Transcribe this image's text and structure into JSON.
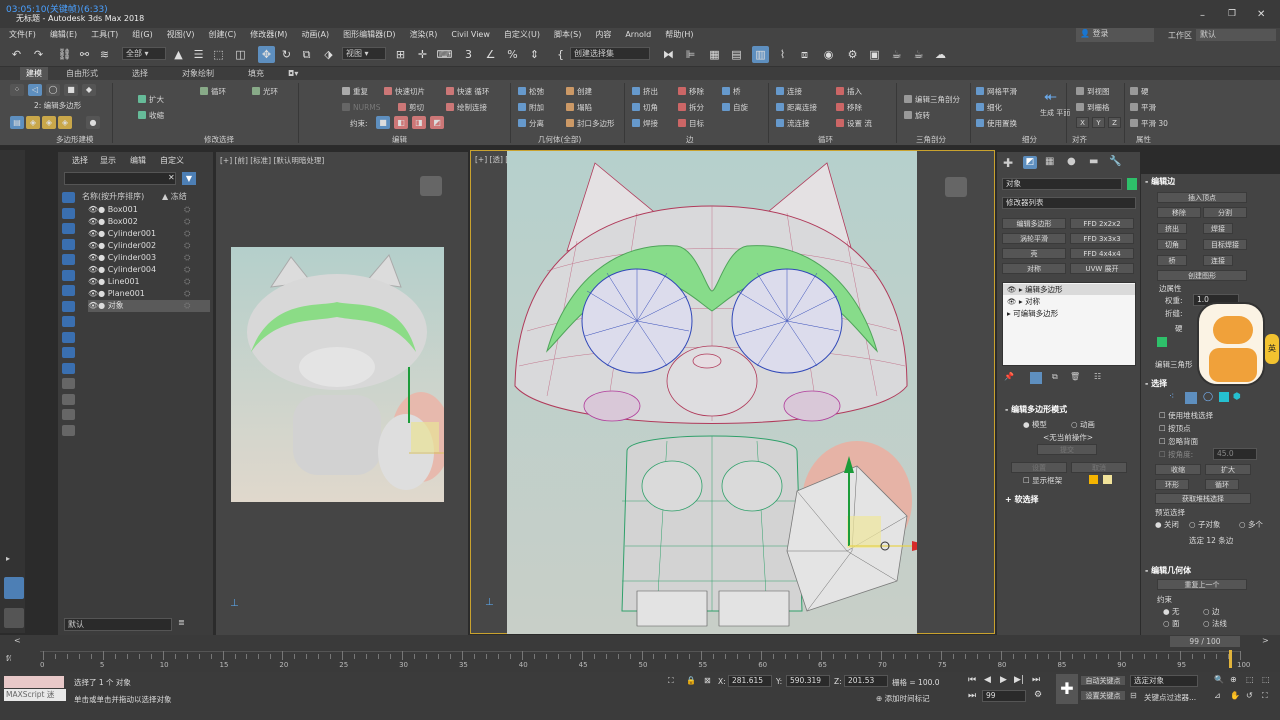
{
  "window": {
    "title": "无标题 - Autodesk 3ds Max 2018",
    "overlay": "03:05:10(关键帧)(6:33)"
  },
  "menu": [
    "文件(F)",
    "编辑(E)",
    "工具(T)",
    "组(G)",
    "视图(V)",
    "创建(C)",
    "修改器(M)",
    "动画(A)",
    "图形编辑器(D)",
    "渲染(R)",
    "Civil View",
    "自定义(U)",
    "脚本(S)",
    "内容",
    "Arnold",
    "帮助(H)"
  ],
  "menu_right": {
    "login": "登录",
    "workspace_label": "工作区",
    "workspace_value": "默认"
  },
  "toolbar": {
    "filter": "全部",
    "view": "视图",
    "selection_set": "创建选择集"
  },
  "ribbon_tabs": [
    "建模",
    "自由形式",
    "选择",
    "对象绘制",
    "填充"
  ],
  "ribbon": {
    "poly_mode": "2: 编辑多边形",
    "groups": [
      "多边形建模",
      "修改选择",
      "编辑",
      "几何体(全部)",
      "边",
      "循环",
      "三角剖分",
      "细分",
      "对齐",
      "属性"
    ],
    "modify_sel": [
      "扩大",
      "收缩",
      "循环",
      "光环"
    ],
    "edit": [
      "重复",
      "快速切片",
      "快速 循环",
      "NURMS",
      "剪切",
      "绘制连接",
      "约束:"
    ],
    "geometry": [
      "松弛",
      "创建",
      "附加",
      "塌陷",
      "分离",
      "封口多边形"
    ],
    "edge": [
      "挤出",
      "移除",
      "桥",
      "切角",
      "拆分",
      "自旋",
      "焊接",
      "目标"
    ],
    "loop": [
      "连接",
      "插入",
      "距离连接",
      "移除",
      "流连接",
      "设置 流"
    ],
    "tri": [
      "编辑三角剖分",
      "旋转"
    ],
    "subdiv": [
      "网格平滑",
      "细化",
      "使用置换",
      "生成 平面"
    ],
    "align": [
      "到视图",
      "到栅格",
      "X",
      "Y",
      "Z"
    ],
    "props": [
      "硬",
      "平滑",
      "平滑 30"
    ]
  },
  "scene_explorer": {
    "tabs": [
      "选择",
      "显示",
      "编辑",
      "自定义"
    ],
    "col_name": "名称(按升序排序)",
    "col_freeze": "▲ 冻结",
    "items": [
      "Box001",
      "Box002",
      "Cylinder001",
      "Cylinder002",
      "Cylinder003",
      "Cylinder004",
      "Line001",
      "Plane001",
      "对象"
    ],
    "layer": "默认"
  },
  "viewports": {
    "left_label": "[+] [前] [标准] [默认明暗处理]",
    "center_label": "[+] [透] [标准]"
  },
  "command_panel": {
    "object_name": "对象",
    "modifier_list": "修改器列表",
    "buttons": [
      "编辑多边形",
      "FFD 2x2x2",
      "涡轮平滑",
      "FFD 3x3x3",
      "壳",
      "FFD 4x4x4",
      "对称",
      "UVW 展开"
    ],
    "stack": [
      "编辑多边形",
      "对称",
      "可编辑多边形"
    ],
    "rollout_mode": "编辑多边形模式",
    "mode_model": "模型",
    "mode_anim": "动画",
    "no_op": "<无当前操作>",
    "commit": "提交",
    "settings": "设置",
    "cancel": "取消",
    "show_cage": "显示框架",
    "soft_sel": "软选择"
  },
  "edit_edge": {
    "title": "编辑边",
    "insert_vertex": "插入顶点",
    "remove": "移除",
    "split": "分割",
    "extrude": "挤出",
    "weld": "焊接",
    "chamfer": "切角",
    "target_weld": "目标焊接",
    "bridge": "桥",
    "connect": "连接",
    "create_shape": "创建图形",
    "edge_props": "边属性",
    "weight": "权重:",
    "weight_val": "1.0",
    "crease": "折缝:",
    "hard": "硬",
    "edit_tri": "编辑三角形"
  },
  "selection": {
    "title": "选择",
    "stack_sel": "使用堆栈选择",
    "by_vertex": "按顶点",
    "ignore_back": "忽略背面",
    "by_angle": "按角度:",
    "angle_val": "45.0",
    "shrink": "收缩",
    "grow": "扩大",
    "ring": "环形",
    "loop": "循环",
    "get_stack": "获取堆栈选择",
    "preview": "预览选择",
    "off": "关闭",
    "subobj": "子对象",
    "multi": "多个",
    "status": "选定 12 条边"
  },
  "edit_geom": {
    "title": "编辑几何体",
    "repeat": "重复上一个",
    "constraint": "约束",
    "none": "无",
    "edge": "边",
    "face": "面",
    "normal": "法线"
  },
  "timeline": {
    "frame_counter": "99 / 100",
    "ticks": [
      "0",
      "5",
      "10",
      "15",
      "20",
      "25",
      "30",
      "35",
      "40",
      "45",
      "50",
      "55",
      "60",
      "65",
      "70",
      "75",
      "80",
      "85",
      "90",
      "95",
      "100"
    ]
  },
  "status": {
    "maxscript": "MAXScript 迷",
    "line1": "选择了 1 个 对象",
    "line2": "单击或单击并拖动以选择对象",
    "x_label": "X:",
    "x": "281.615",
    "y_label": "Y:",
    "y": "590.319",
    "z_label": "Z:",
    "z": "201.53",
    "grid": "栅格 = 100.0",
    "add_tag": "添加时间标记",
    "auto_key": "自动关键点",
    "set_key": "设置关键点",
    "selected": "选定对象",
    "key_filter": "关键点过滤器...",
    "frame": "99"
  },
  "colors": {
    "accent": "#5e8fbf",
    "selection_green": "#7fe07f",
    "viewport_bg": "#b8d1cd"
  }
}
